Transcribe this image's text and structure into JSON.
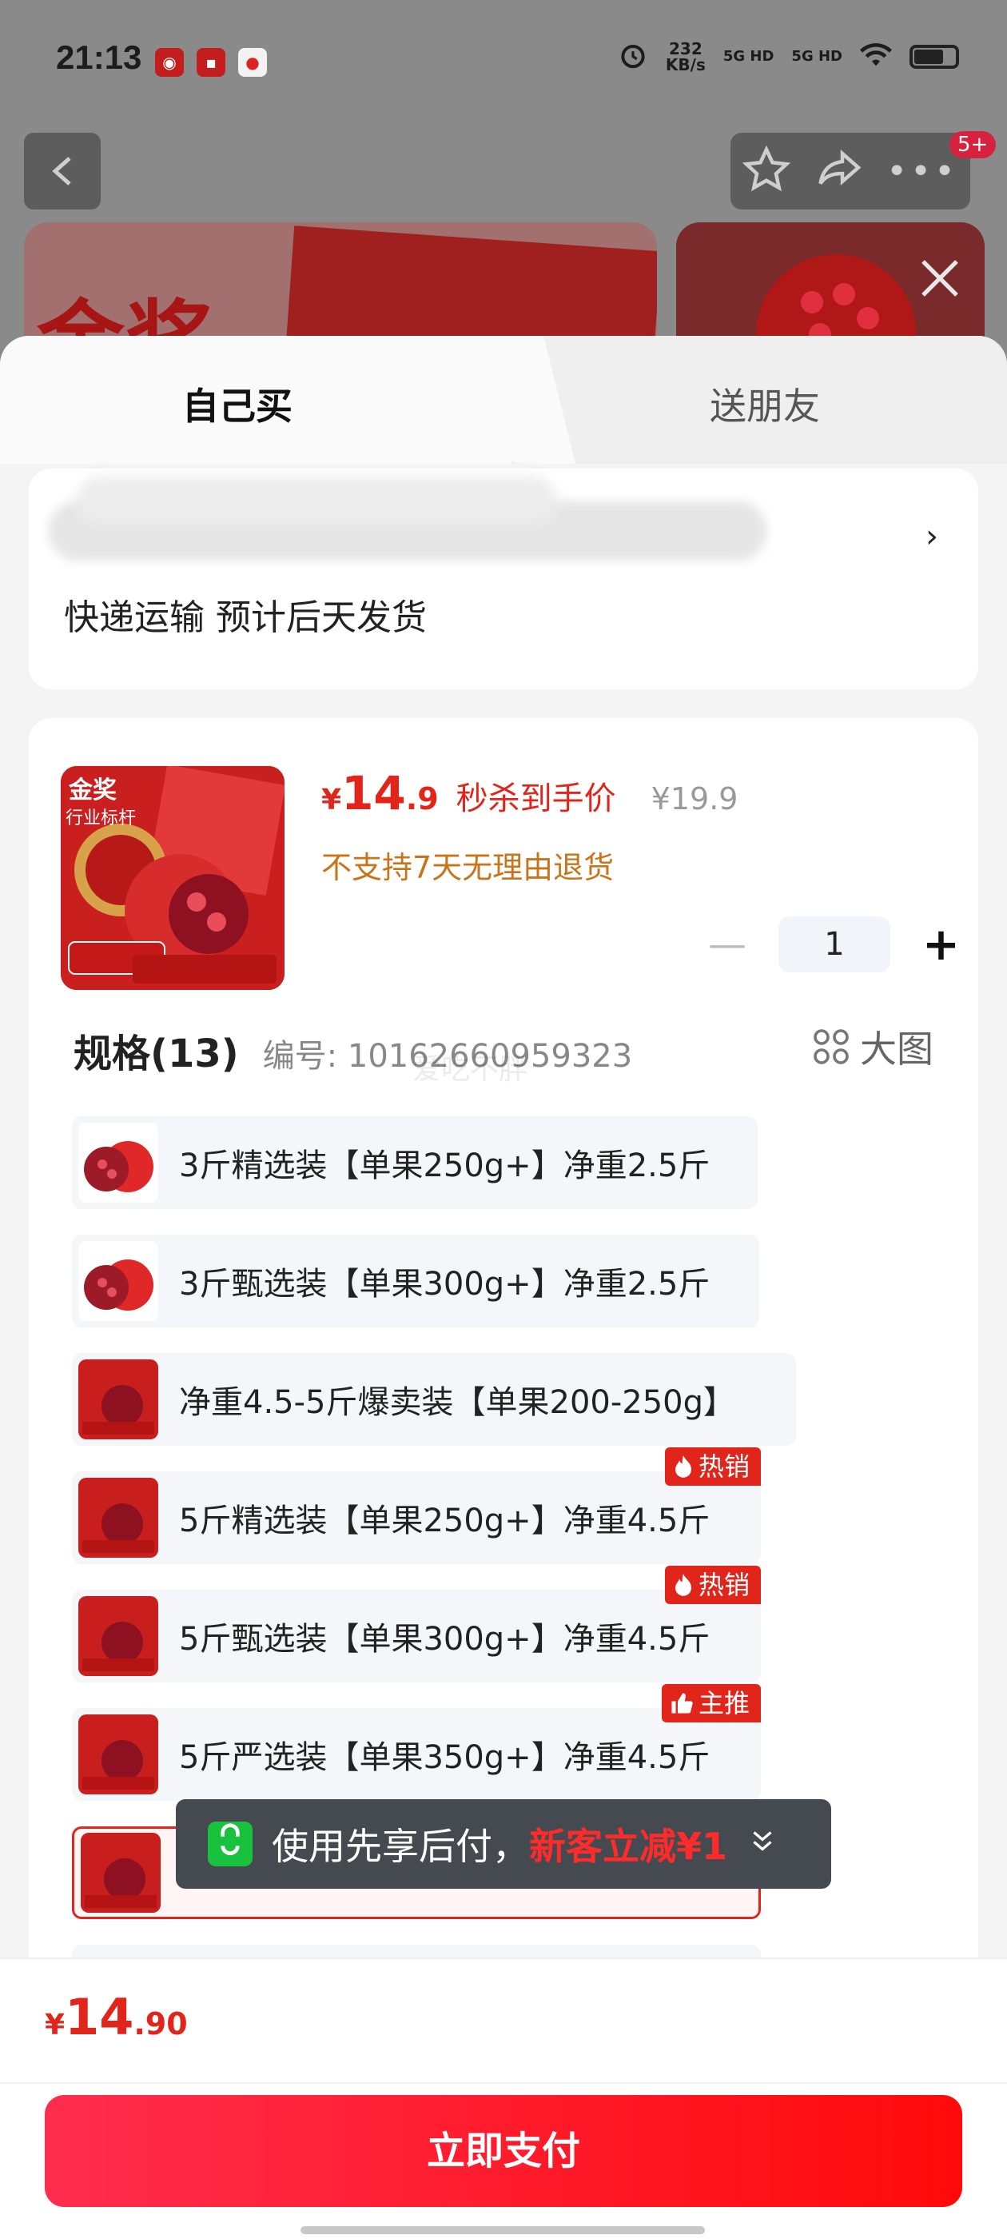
{
  "status_bar": {
    "time": "21:13",
    "speed_value": "232",
    "speed_unit": "KB/s",
    "net1": "5G HD",
    "net2": "5G HD"
  },
  "background": {
    "hero_text": "金奖",
    "more_badge": "5+"
  },
  "tabs": {
    "self_buy": "自己买",
    "gift_friend": "送朋友"
  },
  "address": {
    "shipping_note": "快递运输 预计后天发货"
  },
  "product": {
    "currency": "¥",
    "price_int": "14",
    "price_dec": ".9",
    "price_label": "秒杀到手价",
    "original_price": "¥19.9",
    "return_policy": "不支持7天无理由退货",
    "quantity": "1",
    "spec_title": "规格(13)",
    "spec_code": "编号: 10162660959323",
    "big_image_label": "大图",
    "watermark": "爱吃不胖"
  },
  "specs": [
    {
      "label": "3斤精选装【单果250g+】净重2.5斤",
      "tag": ""
    },
    {
      "label": "3斤甄选装【单果300g+】净重2.5斤",
      "tag": ""
    },
    {
      "label": "净重4.5-5斤爆卖装【单果200-250g】",
      "tag": ""
    },
    {
      "label": "5斤精选装【单果250g+】净重4.5斤",
      "tag": "热销"
    },
    {
      "label": "5斤甄选装【单果300g+】净重4.5斤",
      "tag": "热销"
    },
    {
      "label": "5斤严选装【单果350g+】净重4.5斤",
      "tag": "主推"
    }
  ],
  "toast": {
    "text": "使用先享后付，",
    "highlight": "新客立减¥1"
  },
  "footer": {
    "currency": "¥",
    "total_int": "14",
    "total_dec": ".90",
    "pay_button": "立即支付"
  },
  "colors": {
    "accent": "#e1251b",
    "warning": "#c8741a",
    "toast_bg": "#454a50"
  }
}
